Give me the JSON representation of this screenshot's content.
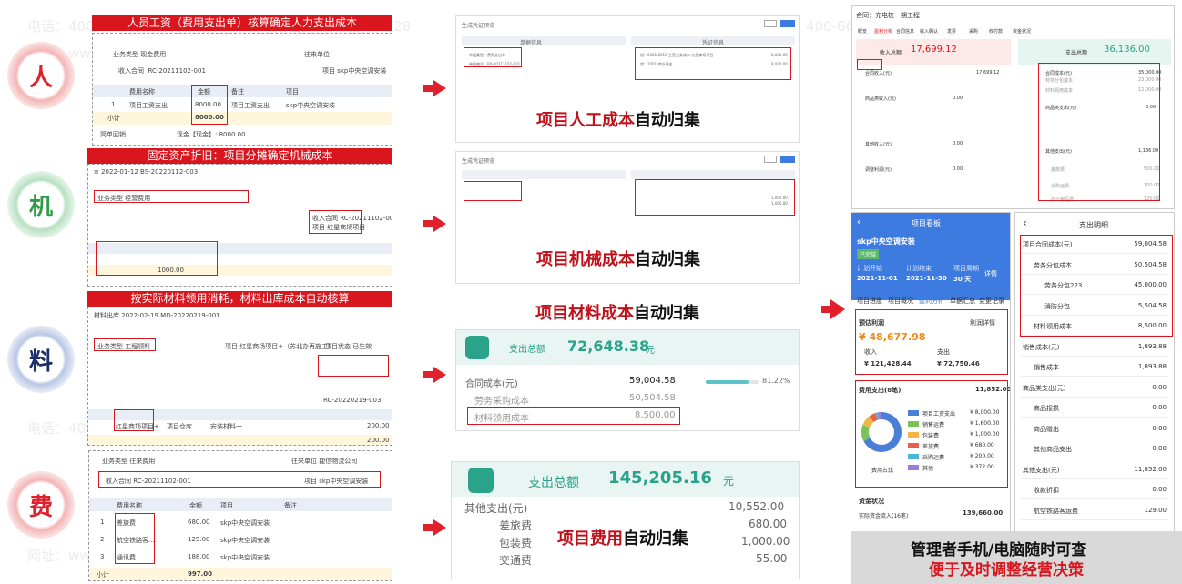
{
  "watermark": {
    "phone": "电话：400-665-0028",
    "site": "网址：www.chanjet.net"
  },
  "letters": {
    "ren": "人",
    "ji": "机",
    "liao": "料",
    "fei": "费"
  },
  "p1": {
    "banner": "人员工资（费用支出单）核算确定人力支出成本",
    "biz": "业务类型",
    "biz_val": "现金费用",
    "vendor": "往来单位",
    "contract": "收入合同",
    "contract_val": "RC-20211102-001",
    "project": "项目",
    "project_val": "skp中央空调安装",
    "cols": [
      "费用名称",
      "金额",
      "备注",
      "项目"
    ],
    "row": [
      "1",
      "项目工资支出",
      "8000.00",
      "项目工资支出",
      "skp中央空调安装"
    ],
    "subtotal": "小计",
    "subtotal_val": "8000.00",
    "settle": "简单回销",
    "settle_val": "现金【现金】: 8000.00"
  },
  "p2": {
    "banner": "固定资产折旧：项目分摊确定机械成本",
    "head": "2022-01-12",
    "code": "BS-20220112-003",
    "biz": "业务类型",
    "biz_val": "经营费用",
    "contract": "收入合同",
    "contract_val": "RC-20211102-001",
    "project": "项目",
    "project_val": "红星商场项目",
    "subtotal": "1000.00"
  },
  "p3": {
    "banner": "按实际材料领用消耗，材料出库成本自动核算",
    "title": "材料出库",
    "date": "2022-02-19",
    "code": "MD-20220219-001",
    "biz": "业务类型",
    "biz_val": "工程领料",
    "project": "项目",
    "project_val": "红星商场项目+（苏北办再施工）",
    "status": "项目状态",
    "status_val": "已生效",
    "item": "红星商场项目+",
    "warehouse": "项目仓库",
    "material": "安装材料一",
    "qty": "200.00",
    "contract_val": "RC-20220219-003",
    "total": "200.00"
  },
  "p4": {
    "biz": "业务类型",
    "biz_val": "往来费用",
    "vendor": "往来单位",
    "vendor_val": "捷信物流公司",
    "contract": "收入合同",
    "contract_val": "RC-20211102-001",
    "project": "项目",
    "project_val": "skp中央空调安装",
    "cols": [
      "费用名称",
      "金额",
      "项目",
      "备注"
    ],
    "rows": [
      [
        "1",
        "差旅费",
        "680.00",
        "skp中央空调安装"
      ],
      [
        "2",
        "航空铁路客...",
        "129.00",
        "skp中央空调安装"
      ],
      [
        "3",
        "通讯费",
        "188.00",
        "skp中央空调安装"
      ]
    ],
    "subtotal": "小计",
    "subtotal_val": "997.00"
  },
  "m1": {
    "title": "生成凭证预览",
    "t1": "单据信息",
    "t2": "凭证信息",
    "l1": "单据类型：费用支出单",
    "l2": "单据编号：BX-20211102-001",
    "v1": "借：6401.0018 主营业务成本-红星商场项目",
    "v2": "贷：1001 库存现金",
    "n1": "8,000.00",
    "n2": "8,000.00",
    "caption_red": "项目人工成本",
    "caption_black": "自动归集"
  },
  "m2": {
    "title": "生成凭证预览",
    "caption_red": "项目机械成本",
    "caption_black": "自动归集",
    "n1": "1,000.00",
    "n2": "1,000.00"
  },
  "m3": {
    "caption_red": "项目材料成本",
    "caption_black": "自动归集",
    "total_label": "支出总额",
    "total": "72,648.38",
    "unit": "元",
    "r1": "合同成本(元)",
    "r1v": "59,004.58",
    "pct": "81.22%",
    "r2": "劳务采购成本",
    "r2v": "50,504.58",
    "r3": "材料领用成本",
    "r3v": "8,500.00"
  },
  "m4": {
    "total_label": "支出总额",
    "total": "145,205.16",
    "unit": "元",
    "r1": "其他支出(元)",
    "r1v": "10,552.00",
    "r2": "差旅费",
    "r2v": "680.00",
    "r3": "包装费",
    "r3v": "1,000.00",
    "r4": "交通费",
    "r4v": "55.00",
    "caption_red": "项目费用",
    "caption_black": "自动归集"
  },
  "dash": {
    "title": "合同：充电桩一期工程",
    "tabs": [
      "概览",
      "盈利分析",
      "合同信息",
      "收入确认",
      "发票",
      "采购",
      "收付款",
      "资金状况"
    ],
    "in_label": "收入总额",
    "in_val": "17,699.12",
    "out_label": "支出总额",
    "out_val": "36,136.00",
    "left": [
      [
        "合同收入(元)",
        "17,699.12"
      ],
      [
        "商品类收入(元)",
        "0.00"
      ],
      [
        "其他收入(元)",
        "0.00"
      ],
      [
        "调整利润(元)",
        "0.00"
      ]
    ],
    "right": [
      [
        "合同成本(元)",
        "35,000.00"
      ],
      [
        "劳务分包成本",
        "23,000.00"
      ],
      [
        "材料领用成本",
        "12,000.00"
      ],
      [
        "商品类支出(元)",
        "0.00"
      ],
      [
        "其他支出(元)",
        "1,136.00"
      ],
      [
        "差旅费",
        "500.00"
      ],
      [
        "采购运费",
        "100.00"
      ],
      [
        "办公用品费",
        "120.00"
      ]
    ]
  },
  "phone1": {
    "bar": "项目看板",
    "project": "skp中央空调安装",
    "status": "已完结",
    "start_l": "计划开始",
    "start": "2021-11-01",
    "end_l": "计划结束",
    "end": "2021-11-30",
    "dur_l": "项目周期",
    "dur": "30 天",
    "detail": "详情",
    "tabs": [
      "项目进度",
      "项目概况",
      "盈利分析",
      "单据汇总",
      "变更记录"
    ],
    "profit_l": "预估利润",
    "profit_d": "利润详情",
    "profit": "¥ 48,677.98",
    "in_l": "收入",
    "in": "¥ 121,428.44",
    "out_l": "支出",
    "out": "¥ 72,750.46",
    "fee_l": "费用支出(8笔)",
    "fee": "11,852.00",
    "ratio": "费用占比",
    "legend": [
      [
        "项目工资支出",
        "¥ 8,000.00",
        "#4a7fd8"
      ],
      [
        "销售运费",
        "¥ 1,600.00",
        "#7ac35a"
      ],
      [
        "包装费",
        "¥ 1,000.00",
        "#f3b644"
      ],
      [
        "差旅费",
        "¥ 680.00",
        "#e8604c"
      ],
      [
        "采购运费",
        "¥ 200.00",
        "#4ab6d8"
      ],
      [
        "其他",
        "¥ 372.00",
        "#9b7ad8"
      ]
    ],
    "cash_l": "资金状况",
    "cash_in_l": "实际资金流入(16笔)",
    "cash_in": "139,660.00"
  },
  "phone2": {
    "bar": "支出明细",
    "rows": [
      [
        "项目合同成本(元)",
        "59,004.58"
      ],
      [
        "劳务分包成本",
        "50,504.58"
      ],
      [
        "劳务分包223",
        "45,000.00"
      ],
      [
        "消防分包",
        "5,504.58"
      ],
      [
        "材料领用成本",
        "8,500.00"
      ],
      [
        "销售成本(元)",
        "1,893.88"
      ],
      [
        "销售成本",
        "1,893.88"
      ],
      [
        "商品类支出(元)",
        "0.00"
      ],
      [
        "商品报损",
        "0.00"
      ],
      [
        "商品赠出",
        "0.00"
      ],
      [
        "其他商品支出",
        "0.00"
      ],
      [
        "其他支出(元)",
        "11,852.00"
      ],
      [
        "收款折扣",
        "0.00"
      ],
      [
        "航空铁路客运费",
        "129.00"
      ]
    ]
  },
  "footer": {
    "l1": "管理者手机/电脑随时可查",
    "l2": "便于及时调整经营决策"
  }
}
